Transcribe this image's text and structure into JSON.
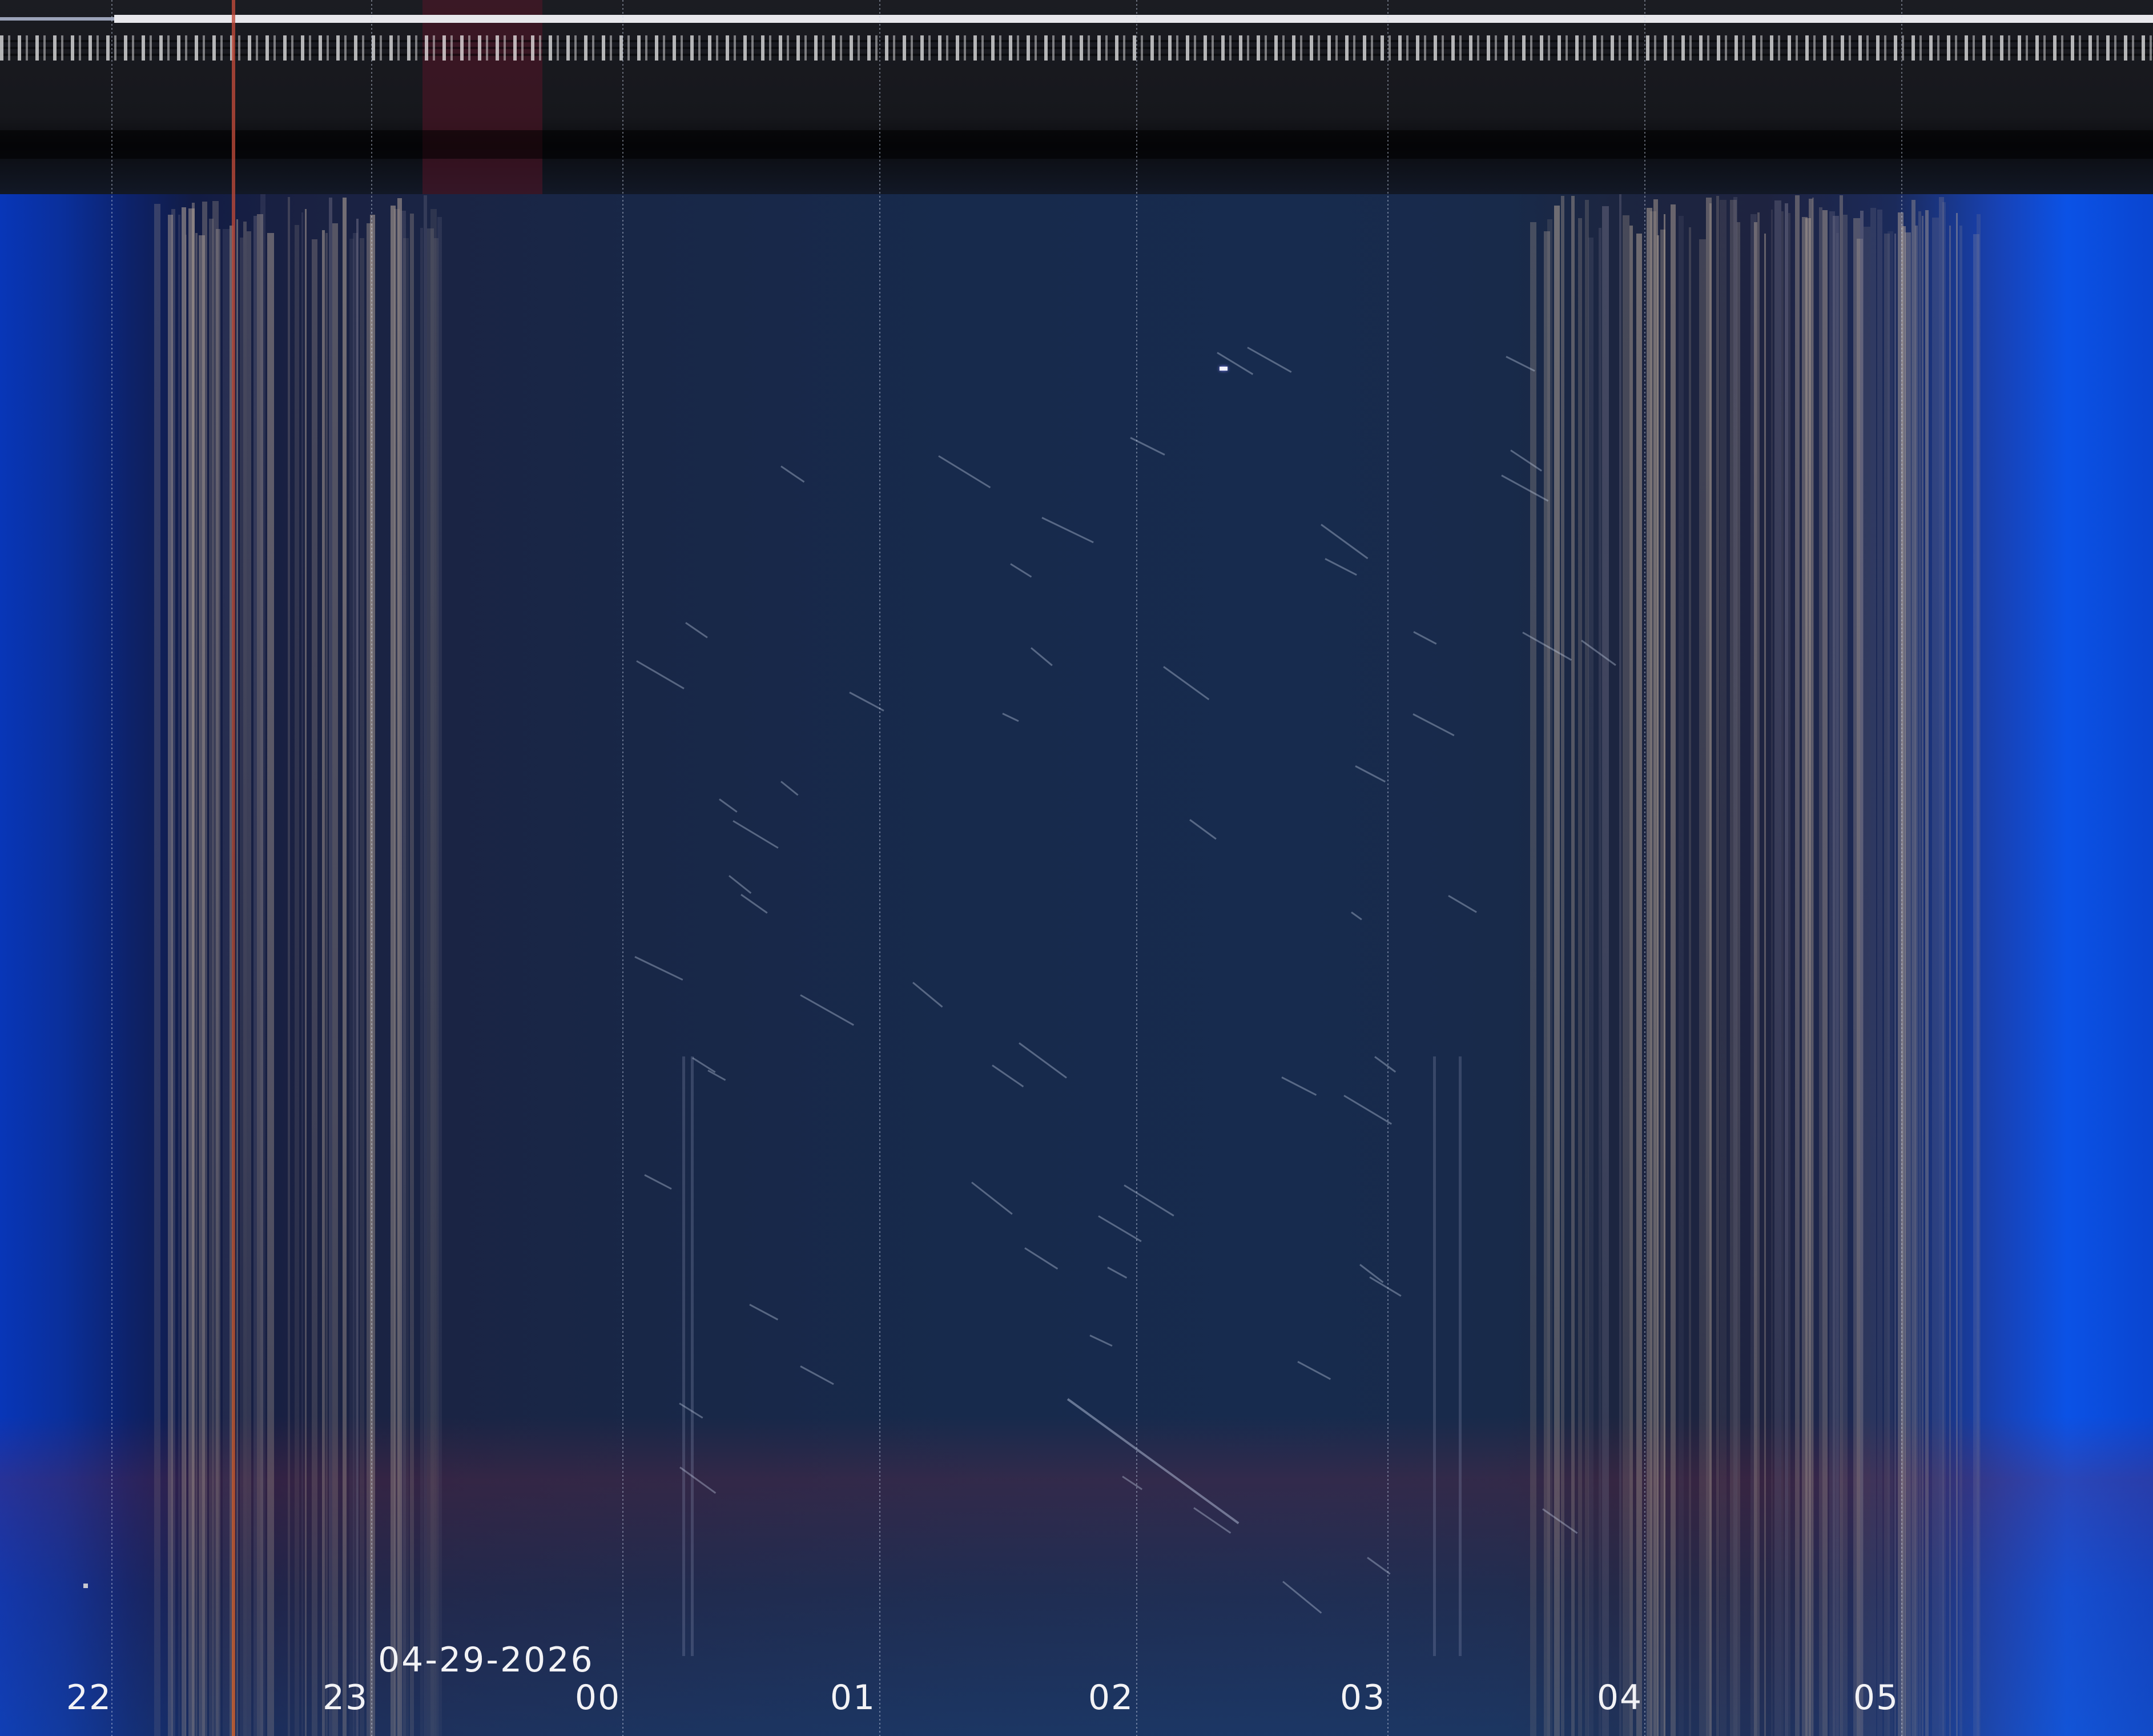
{
  "image": {
    "kind": "night-sky keogram",
    "date": "04-29-2026",
    "hour_ticks": [
      "22",
      "23",
      "00",
      "01",
      "02",
      "03",
      "04",
      "05"
    ]
  },
  "colors": {
    "twilight_blue": "#0b52e6",
    "night_sky": "#172a4c",
    "cloud_tan": "#b8a89a",
    "label_text": "#f2f2f5",
    "header_bar": "#1b1c22"
  }
}
